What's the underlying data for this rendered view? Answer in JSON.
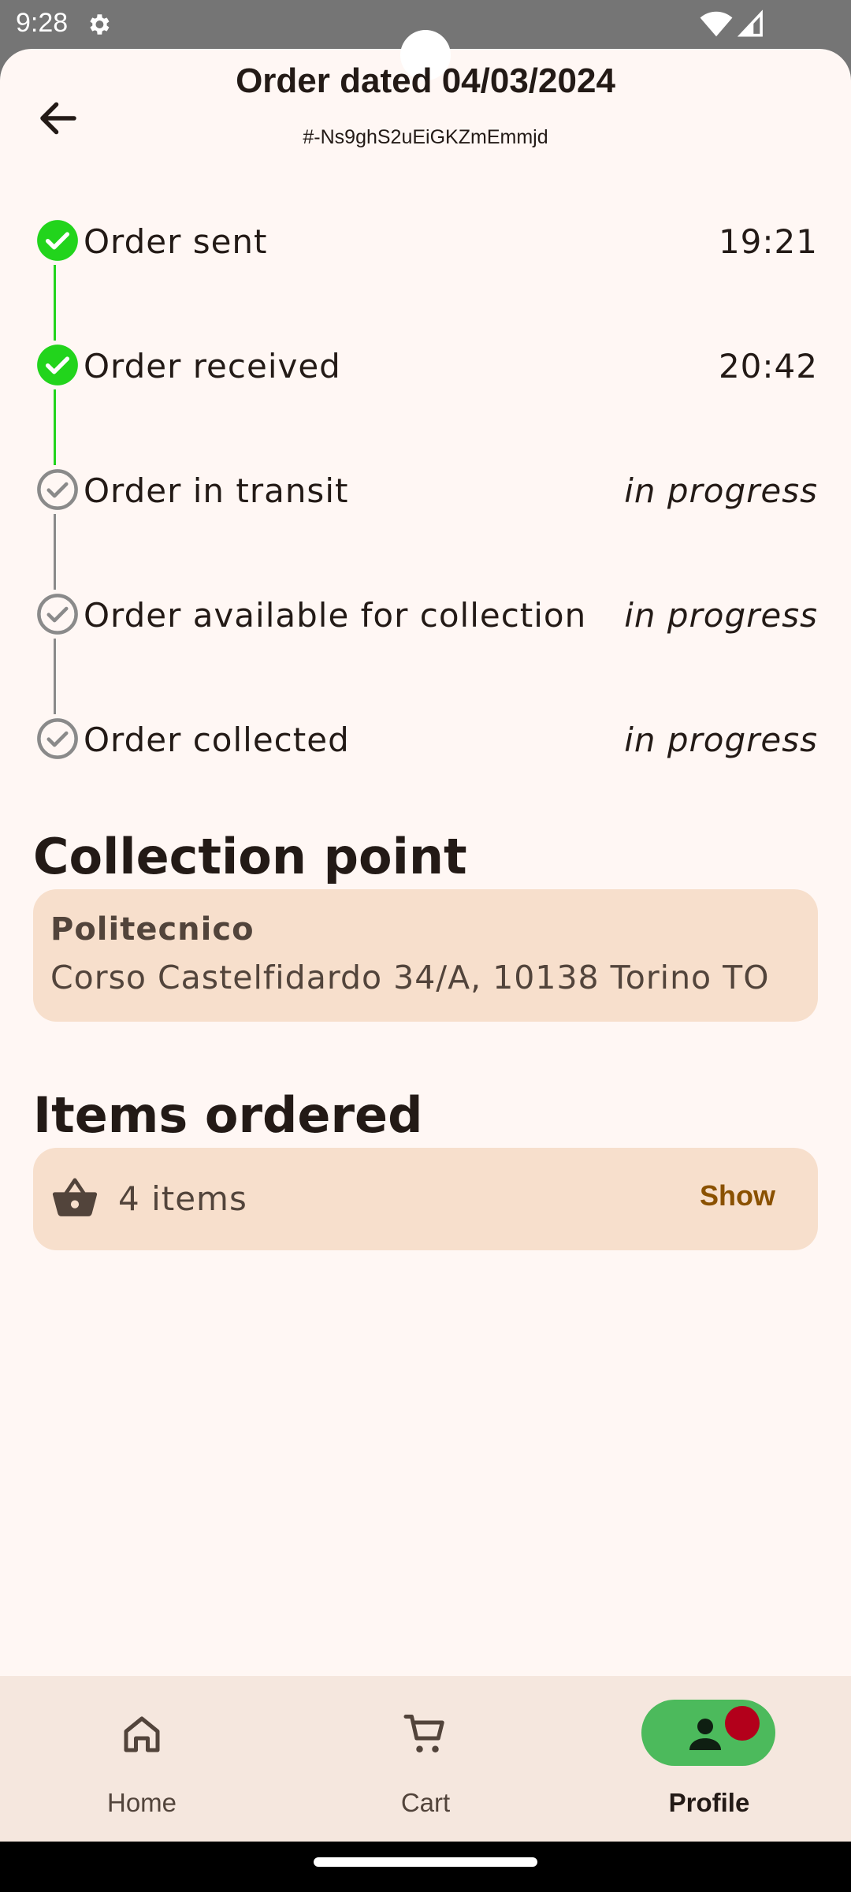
{
  "status_bar": {
    "time": "9:28",
    "icons": [
      "gear-icon",
      "wifi-icon",
      "signal-icon"
    ]
  },
  "header": {
    "title": "Order dated 04/03/2024",
    "order_id": "#-Ns9ghS2uEiGKZmEmmjd",
    "back_icon": "arrow-left-icon"
  },
  "timeline": {
    "colors": {
      "done": "#22d41c",
      "todo": "#8a8a8a"
    },
    "steps": [
      {
        "label": "Order sent",
        "time": "19:21",
        "status": "done"
      },
      {
        "label": "Order received",
        "time": "20:42",
        "status": "done"
      },
      {
        "label": "Order in transit",
        "time": "in progress",
        "status": "pending"
      },
      {
        "label": "Order available for collection",
        "time": "in progress",
        "status": "pending"
      },
      {
        "label": "Order collected",
        "time": "in progress",
        "status": "pending"
      }
    ]
  },
  "collection_point": {
    "title": "Collection point",
    "name": "Politecnico",
    "address": "Corso Castelfidardo 34/A, 10138 Torino TO"
  },
  "items_ordered": {
    "title": "Items ordered",
    "count_label": "4 items",
    "show_label": "Show",
    "icon": "basket-icon"
  },
  "bottom_nav": {
    "items": [
      {
        "label": "Home",
        "icon": "home-icon",
        "active": false
      },
      {
        "label": "Cart",
        "icon": "cart-icon",
        "active": false
      },
      {
        "label": "Profile",
        "icon": "person-icon",
        "active": true
      }
    ],
    "accent": "#4cba5c",
    "badge_color": "#b3001b"
  }
}
